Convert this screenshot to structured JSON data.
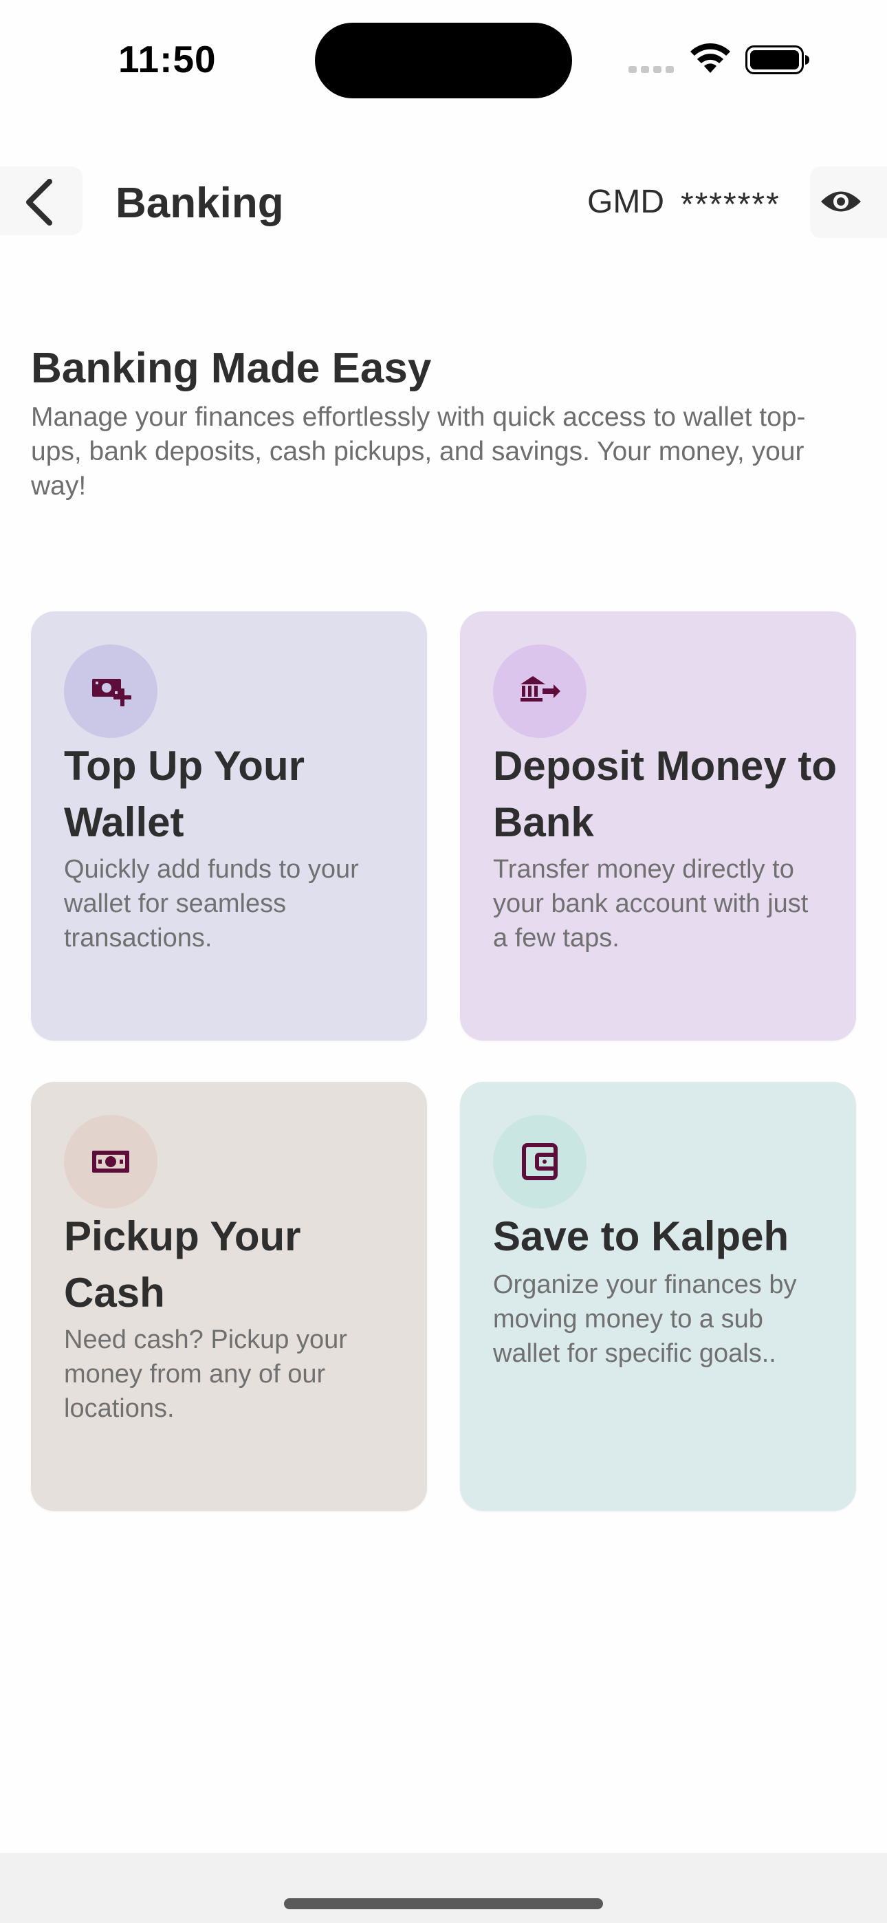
{
  "status_bar": {
    "time": "11:50"
  },
  "header": {
    "back_icon": "chevron-left-icon",
    "title": "Banking",
    "currency": "GMD",
    "balance_masked": "*******",
    "visibility_icon": "eye-icon"
  },
  "intro": {
    "title": "Banking Made Easy",
    "description": "Manage your finances effortlessly with quick access to wallet top-ups, bank deposits, cash pickups, and savings. Your money, your way!"
  },
  "cards": [
    {
      "icon": "money-plus-icon",
      "title": "Top Up Your Wallet",
      "description": "Quickly add funds to your wallet for seamless transactions.",
      "background": "#e0dfee"
    },
    {
      "icon": "bank-transfer-icon",
      "title": "Deposit Money to Bank",
      "description": "Transfer money directly to your bank account with just a few taps.",
      "background": "#e7dcef"
    },
    {
      "icon": "cash-icon",
      "title": "Pickup Your Cash",
      "description": "Need cash? Pickup your money from any of our locations.",
      "background": "#e6e0dc"
    },
    {
      "icon": "wallet-icon",
      "title": "Save to Kalpeh",
      "description": "Organize your finances by moving money to a sub wallet for specific goals..",
      "background": "#dbeaea"
    }
  ],
  "colors": {
    "icon_accent": "#5c0d3a",
    "text_dark": "#2e2e2e",
    "text_muted": "#707070"
  }
}
